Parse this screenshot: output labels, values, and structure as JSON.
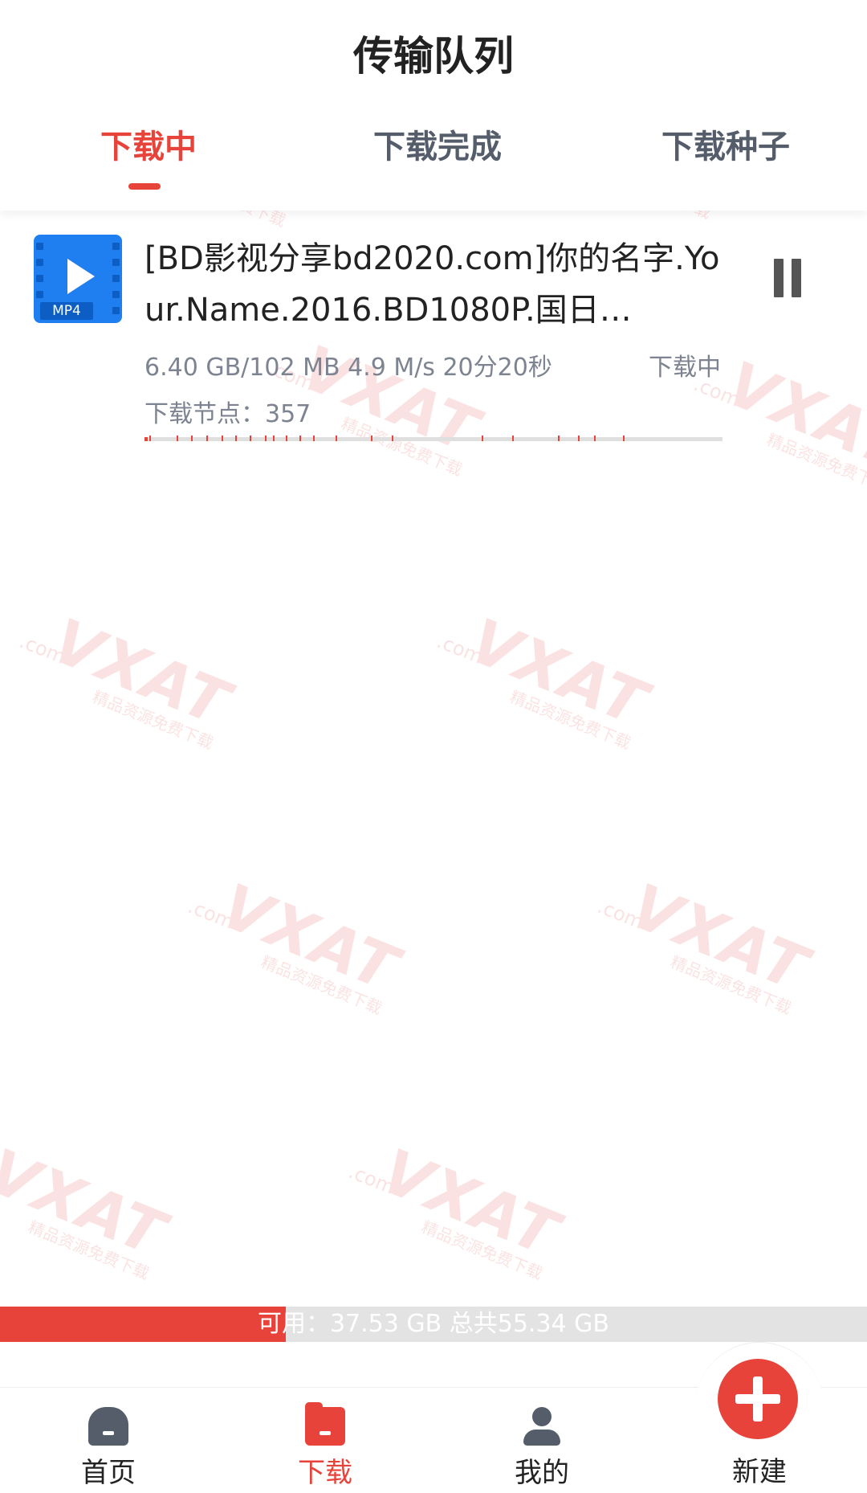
{
  "header": {
    "title": "传输队列"
  },
  "tabs": [
    {
      "label": "下载中",
      "active": true
    },
    {
      "label": "下载完成",
      "active": false
    },
    {
      "label": "下载种子",
      "active": false
    }
  ],
  "downloads": [
    {
      "icon": "mp4-video-icon",
      "icon_label": "MP4",
      "name": "[BD影视分享bd2020.com]你的名字.Your.Name.2016.BD1080P.国日…",
      "stats": "6.40 GB/102 MB  4.9 M/s  20分20秒",
      "status": "下载中",
      "nodes_label": "下载节点：357",
      "action": "pause-icon"
    }
  ],
  "watermark": {
    "text": "VXAT",
    "sub": "精品资源免费下载",
    "com": ".com"
  },
  "storage": {
    "text": "可用：37.53 GB 总共55.34 GB",
    "used_fraction": 0.33
  },
  "bottom_nav": [
    {
      "label": "首页",
      "icon": "home-icon",
      "active": false
    },
    {
      "label": "下载",
      "icon": "download-folder-icon",
      "active": true
    },
    {
      "label": "我的",
      "icon": "user-icon",
      "active": false
    }
  ],
  "new_button": {
    "label": "新建",
    "icon": "plus-icon"
  },
  "colors": {
    "accent": "#e8433a",
    "text_secondary": "#7d8390",
    "icon_blue": "#1f7ff0"
  }
}
